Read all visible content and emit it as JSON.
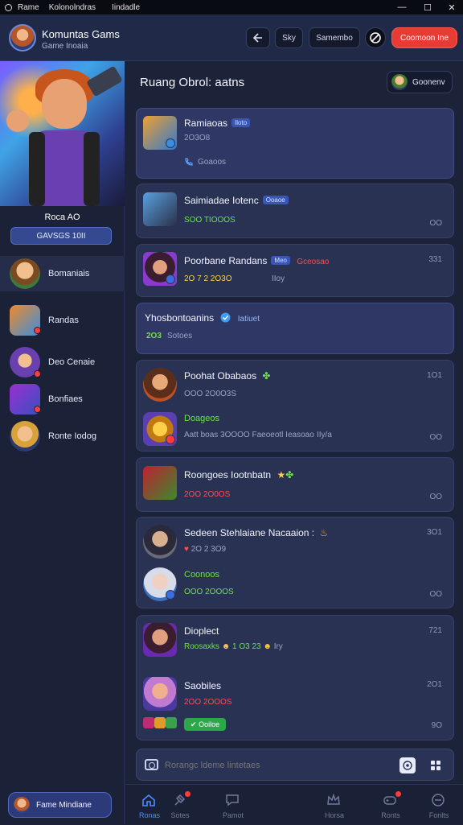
{
  "window": {
    "title_left": "Rame",
    "title_app": "Kolonolndras",
    "title_right": "Iindadle",
    "minimize": "—",
    "maximize": "☐",
    "close": "✕"
  },
  "header": {
    "title": "Komuntas Gams",
    "subtitle": "Game Inoaia",
    "buttons": {
      "sky": "Sky",
      "samembo": "Samembo",
      "cta": "Coomoon Ine"
    }
  },
  "sidebar": {
    "profile_name": "Roca AO",
    "profile_button": "GAVSGS 10II",
    "items": [
      {
        "label": "Bomaniais"
      },
      {
        "label": "Randas"
      },
      {
        "label": "Deo Cenaie"
      },
      {
        "label": "Bonfiaes"
      },
      {
        "label": "Ronte Iodog"
      }
    ],
    "bottom_user": "Fame Mindiane"
  },
  "main": {
    "title": "Ruang Obrol: aatns",
    "top_button": "Goonenv",
    "cards": [
      {
        "name": "Ramiaoas",
        "pill": "Iloto",
        "line2": "2O3O8",
        "line3": "Goaoos"
      },
      {
        "name": "Saimiadae Iotenc",
        "pill": "Ooaoe",
        "line2": "SOO TIOOOS",
        "right": "OO"
      },
      {
        "name": "Poorbane Randans",
        "pill": "Meo",
        "extra": "Gceosao",
        "line2": "2O 7 2 2O3O",
        "line3": "IIoy",
        "right": "331"
      },
      {
        "name": "Yhosbontoanins",
        "extra": "Iatiuet",
        "line2": "2O3",
        "line3": "Sotoes"
      },
      {
        "name": "Poohat Obabaos",
        "line2": "OOO 2O0O3S",
        "name2": "Doageos",
        "line4": "Aatt boas 3OOOO  Faeoeotl Ieasoao",
        "line4b": "IIy/a",
        "right1": "1O1",
        "right2": "OO"
      },
      {
        "name": "Roongoes Iootnbatn",
        "line2": "2OO 2O0OS",
        "right": "OO"
      },
      {
        "name": "Sedeen Stehlaiane Nacaaion :",
        "line2": "2O 2 3O9",
        "name2": "Coonoos",
        "line3": "OOO 2OOOS",
        "right1": "3O1",
        "right2": "OO"
      },
      {
        "name": "Dioplect",
        "line2": "Roosaxks",
        "line2b": "1 O3 23",
        "line2c": "Iry",
        "name2": "Saobiles",
        "line3": "2OO 2OOOS",
        "tag": "Ooiloe",
        "right1": "721",
        "right2": "2O1",
        "right3": "9O"
      }
    ],
    "composer_placeholder": "Rorangc ldeme lintetaes"
  },
  "tabs": [
    {
      "label": "Ronas"
    },
    {
      "label": "Sotes"
    },
    {
      "label": "Pamot"
    },
    {
      "label": "Horsa"
    },
    {
      "label": "Ronts"
    },
    {
      "label": "Fonlts"
    }
  ]
}
